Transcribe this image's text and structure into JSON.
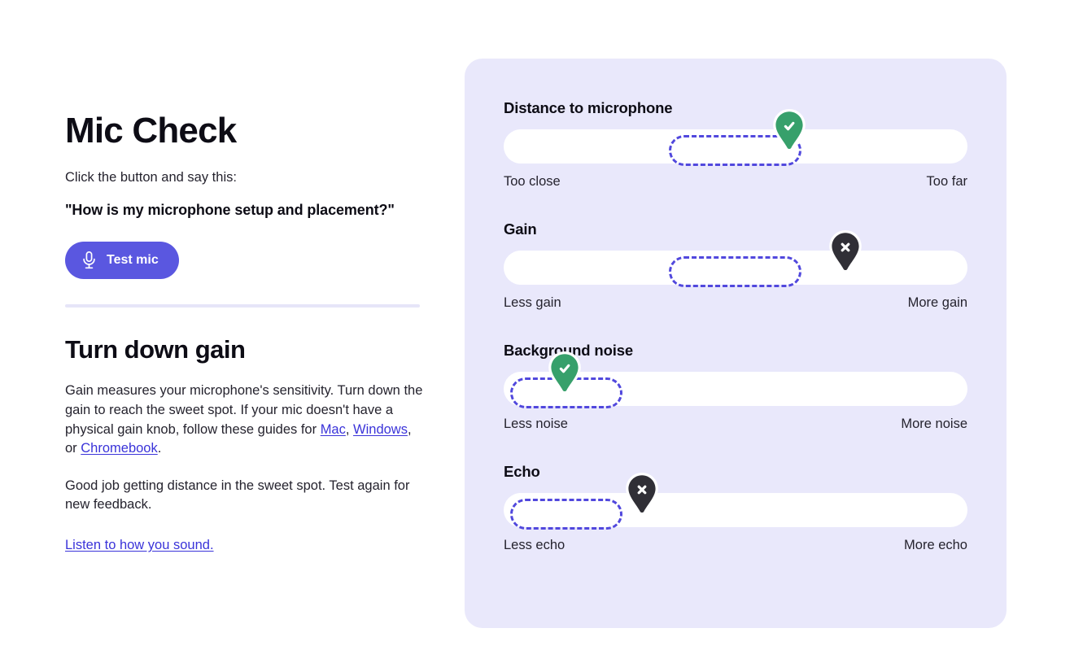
{
  "app": {
    "title": "Mic Check",
    "prompt_lead": "Click the button and say this:",
    "prompt_phrase": "\"How is my microphone setup and placement?\"",
    "test_button_label": "Test mic",
    "test_button_icon": "microphone-icon",
    "accent_color": "#5a57e0",
    "panel_color": "#e9e8fb",
    "zone_border_color": "#5148dd",
    "good_marker_color": "#37a06b",
    "bad_marker_color": "#302f36",
    "link_color": "#3a33d9"
  },
  "advice": {
    "heading": "Turn down gain",
    "paragraph_1": {
      "part_1": "Gain measures your microphone's sensitivity. Turn down the gain to reach the sweet spot. If your mic doesn't have a physical gain knob, follow these guides for ",
      "link_mac": "Mac",
      "separator_1": ", ",
      "link_windows": "Windows",
      "separator_2": ", or ",
      "link_chromebook": "Chromebook",
      "part_end": "."
    },
    "paragraph_2": "Good job getting distance in the sweet spot. Test again for new feedback.",
    "listen_link": "Listen to how you sound."
  },
  "meters": [
    {
      "label": "Distance to microphone",
      "min_label": "Too close",
      "max_label": "Too far",
      "zone_start_pct": 35.6,
      "zone_end_pct": 64.2,
      "marker_pct": 61.6,
      "marker_status": "good",
      "marker_icon": "check-pin-icon"
    },
    {
      "label": "Gain",
      "min_label": "Less gain",
      "max_label": "More gain",
      "zone_start_pct": 35.6,
      "zone_end_pct": 64.2,
      "marker_pct": 73.6,
      "marker_status": "bad",
      "marker_icon": "x-pin-icon"
    },
    {
      "label": "Background noise",
      "min_label": "Less noise",
      "max_label": "More noise",
      "zone_start_pct": 1.4,
      "zone_end_pct": 25.6,
      "marker_pct": 13.2,
      "marker_status": "good",
      "marker_icon": "check-pin-icon"
    },
    {
      "label": "Echo",
      "min_label": "Less echo",
      "max_label": "More echo",
      "zone_start_pct": 1.4,
      "zone_end_pct": 25.6,
      "marker_pct": 29.8,
      "marker_status": "bad",
      "marker_icon": "x-pin-icon"
    }
  ]
}
